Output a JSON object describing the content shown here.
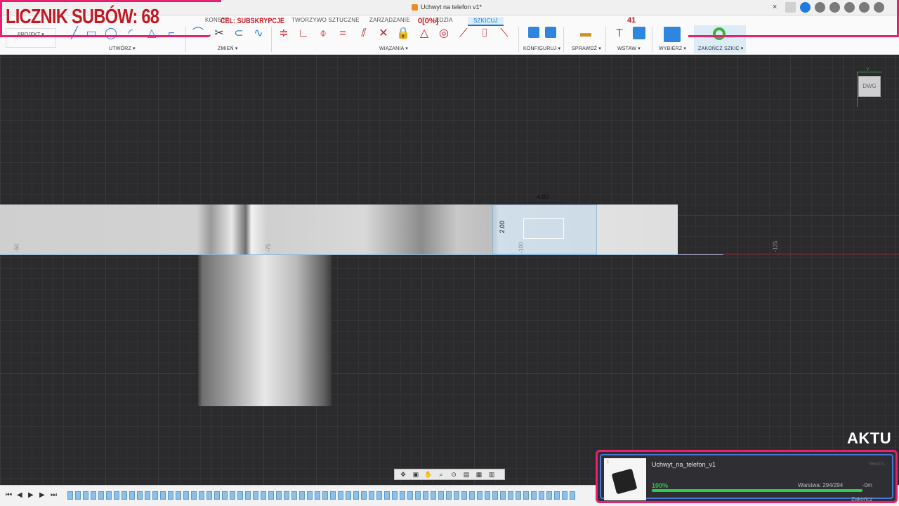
{
  "window": {
    "doc_title": "Uchwyt na telefon v1*",
    "close": "×"
  },
  "ribbon": {
    "tabs": [
      "KONSTR",
      "TWORZYWO SZTUCZNE",
      "ZARZĄDZANIE",
      "EDZIA",
      "SZKICUJ"
    ],
    "active_tab": "SZKICUJ",
    "projekt": "PROJEKT ▾",
    "groups": {
      "create": "UTWÓRZ ▾",
      "modify": "ZMIEŃ ▾",
      "constraints": "WIĄZANIA ▾",
      "configure": "KONFIGURUJ ▾",
      "inspect": "SPRAWDŹ ▾",
      "insert": "WSTAW ▾",
      "select": "WYBIERZ ▾",
      "finish": "ZAKOŃCZ SZKIC ▾"
    }
  },
  "overlay": {
    "sub_counter": "LICZNIK SUBÓW: 68",
    "goal_label": "CEL: SUBSKRYPCJE",
    "goal_percent": "0[0%]",
    "goal_number": "41",
    "aktu": "AKTU"
  },
  "canvas": {
    "dim_width": "4.00",
    "dim_height": "2.00",
    "coord_left": "-50",
    "coord_mid": "-75",
    "coord_mid2": "-100",
    "coord_right": "-125",
    "viewcube_label": "DWG",
    "axis_y": "Y"
  },
  "printer": {
    "slot": "1",
    "filename": "Uchwyt_na_telefon_v1",
    "elapsed": "58m27s",
    "progress_label": "100%",
    "progress_value": 1.0,
    "layer": "Warstwa: 294/294",
    "remaining": "-0m",
    "finish_button": "Zakończ"
  },
  "colors": {
    "accent_pink": "#e8206e",
    "overlay_red": "#c21a24",
    "ribbon_blue": "#1a73c9",
    "progress_green": "#2ecc4a"
  }
}
